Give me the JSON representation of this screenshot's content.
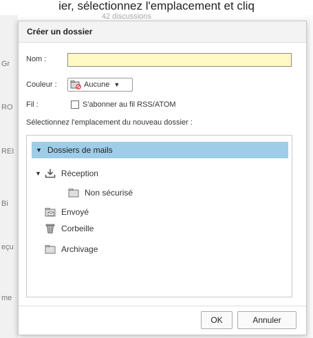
{
  "background": {
    "top_text": "ier, sélectionnez l'emplacement et cliq",
    "meta_text": "42 discussions",
    "left_fragments": [
      "Gr",
      "RO",
      "REI",
      "Bi",
      "eçu",
      "me"
    ]
  },
  "dialog": {
    "title": "Créer un dossier",
    "name_label": "Nom :",
    "name_value": "",
    "color_label": "Couleur :",
    "color_value": "Aucune",
    "feed_label": "Fil :",
    "feed_checkbox_label": "S'abonner au fil RSS/ATOM",
    "location_label": "Sélectionnez l'emplacement du nouveau dossier :",
    "tree": {
      "root": "Dossiers de mails",
      "items": [
        {
          "label": "Réception",
          "icon": "download-icon"
        },
        {
          "label": "Non sécurisé",
          "icon": "folder-icon"
        },
        {
          "label": "Envoyé",
          "icon": "sent-folder-icon"
        },
        {
          "label": "Corbeille",
          "icon": "trash-icon"
        },
        {
          "label": "Archivage",
          "icon": "folder-icon"
        }
      ]
    },
    "ok_label": "OK",
    "cancel_label": "Annuler"
  },
  "colors": {
    "selected_row": "#9fcde8",
    "name_input_bg": "#fff9c4"
  }
}
